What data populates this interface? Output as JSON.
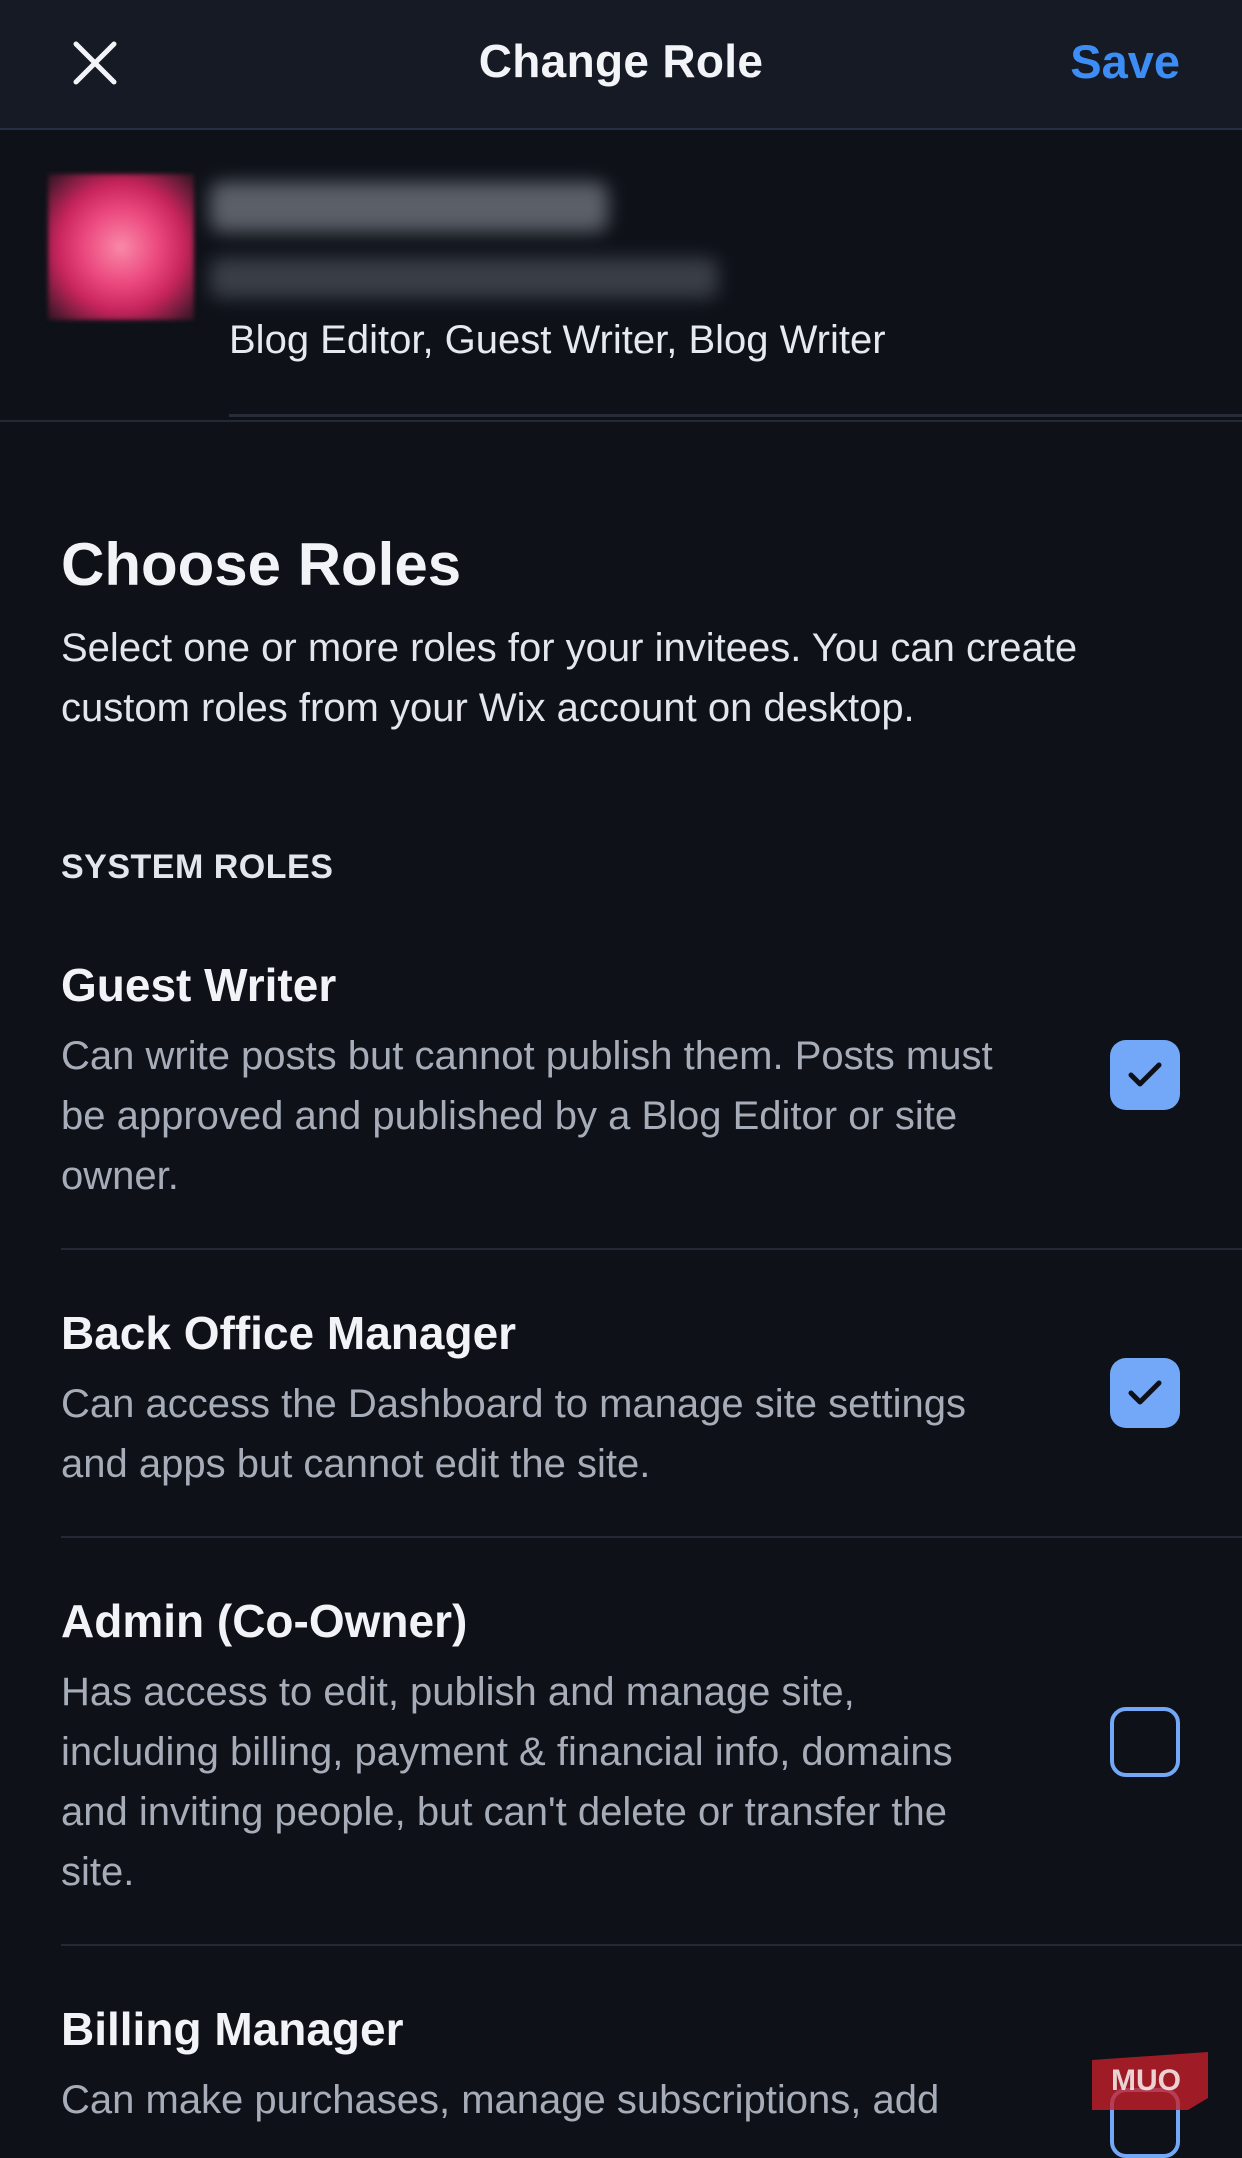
{
  "header": {
    "title": "Change Role",
    "save_label": "Save",
    "close_icon": "close-icon"
  },
  "user": {
    "roles_text": "Blog Editor, Guest Writer, Blog Writer"
  },
  "choose": {
    "title": "Choose Roles",
    "description": "Select one or more roles for your invitees. You can create custom roles from your Wix account on desktop."
  },
  "system_roles": {
    "label": "SYSTEM ROLES",
    "items": [
      {
        "title": "Guest Writer",
        "description": "Can write posts but cannot publish them. Posts must be approved and published by a Blog Editor or site owner.",
        "checked": true
      },
      {
        "title": "Back Office Manager",
        "description": "Can access the Dashboard to manage site settings and apps but cannot edit the site.",
        "checked": true
      },
      {
        "title": "Admin (Co-Owner)",
        "description": "Has access to edit, publish and manage site, including billing, payment & financial info, domains and inviting people, but can't delete or transfer the site.",
        "checked": false
      },
      {
        "title": "Billing Manager",
        "description": "Can make purchases, manage subscriptions, add",
        "checked": false
      }
    ]
  },
  "watermark": {
    "text": "MUO"
  },
  "colors": {
    "accent": "#3d8df6",
    "checkbox": "#72a8f7",
    "background": "#0e1118",
    "header_bg": "#151a24",
    "watermark": "#c8202a"
  }
}
